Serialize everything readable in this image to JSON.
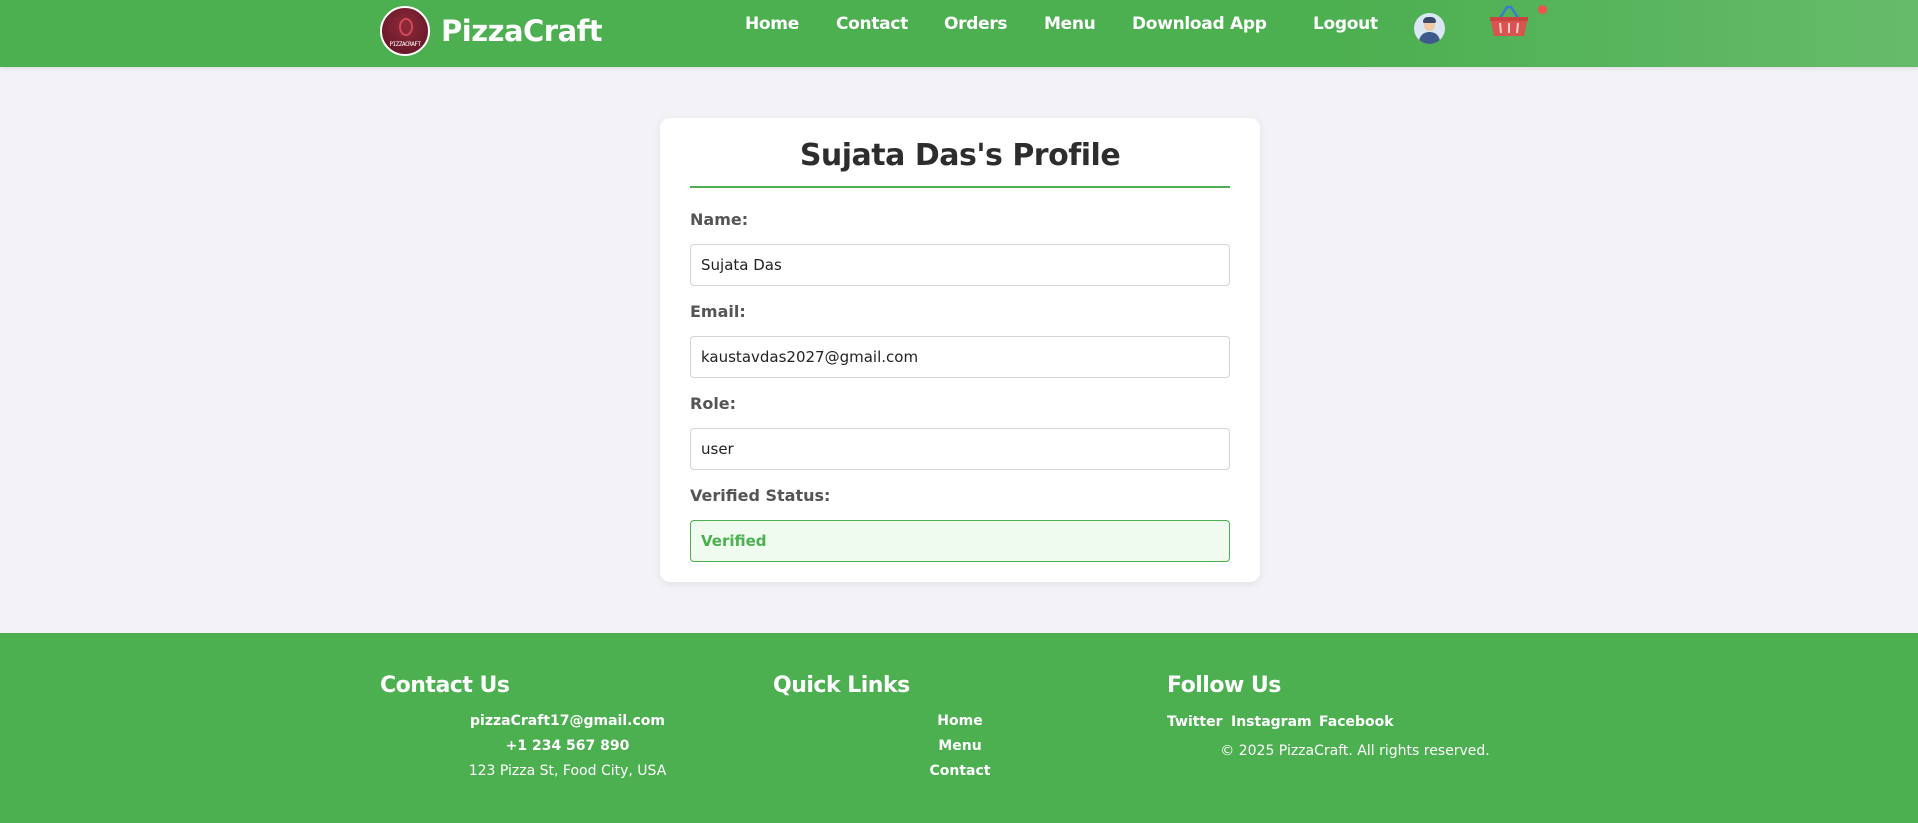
{
  "brand": {
    "name": "PizzaCraft",
    "logo_text": "PIZZACRAFT"
  },
  "nav": {
    "items": [
      {
        "label": "Home"
      },
      {
        "label": "Contact"
      },
      {
        "label": "Orders"
      },
      {
        "label": "Menu"
      },
      {
        "label": "Download App"
      },
      {
        "label": "Logout"
      }
    ]
  },
  "profile": {
    "title": "Sujata Das's Profile",
    "fields": [
      {
        "label": "Name:",
        "value": "Sujata Das"
      },
      {
        "label": "Email:",
        "value": "kaustavdas2027@gmail.com"
      },
      {
        "label": "Role:",
        "value": "user"
      },
      {
        "label": "Verified Status:",
        "value": "Verified"
      }
    ]
  },
  "footer": {
    "contact": {
      "heading": "Contact Us",
      "email": "pizzaCraft17@gmail.com",
      "phone": "+1 234 567 890",
      "address": "123 Pizza St, Food City, USA"
    },
    "quick_links": {
      "heading": "Quick Links",
      "items": [
        "Home",
        "Menu",
        "Contact"
      ]
    },
    "follow": {
      "heading": "Follow Us",
      "items": [
        "Twitter",
        "Instagram",
        "Facebook"
      ],
      "copyright": "© 2025 PizzaCraft. All rights reserved."
    }
  },
  "colors": {
    "primary": "#4caf50",
    "verified_bg": "#eefbee",
    "page_bg": "#f3f3f7",
    "cart_dot": "#ef5350",
    "basket": "#d9534f"
  },
  "icons": {
    "avatar": "user-avatar-icon",
    "cart": "shopping-basket-icon"
  }
}
